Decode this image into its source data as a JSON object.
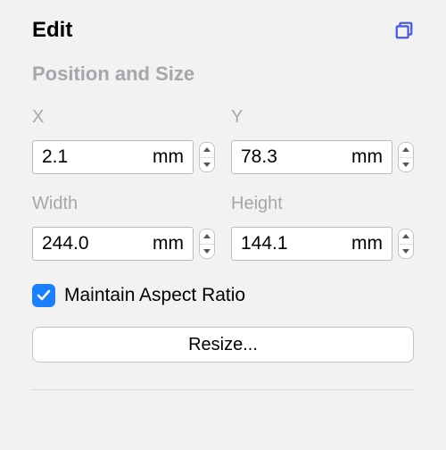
{
  "header": {
    "title": "Edit"
  },
  "section": {
    "title": "Position and Size"
  },
  "fields": {
    "x": {
      "label": "X",
      "value": "2.1",
      "unit": "mm"
    },
    "y": {
      "label": "Y",
      "value": "78.3",
      "unit": "mm"
    },
    "width": {
      "label": "Width",
      "value": "244.0",
      "unit": "mm"
    },
    "height": {
      "label": "Height",
      "value": "144.1",
      "unit": "mm"
    }
  },
  "aspect": {
    "checked": true,
    "label": "Maintain Aspect Ratio"
  },
  "resize": {
    "label": "Resize..."
  }
}
